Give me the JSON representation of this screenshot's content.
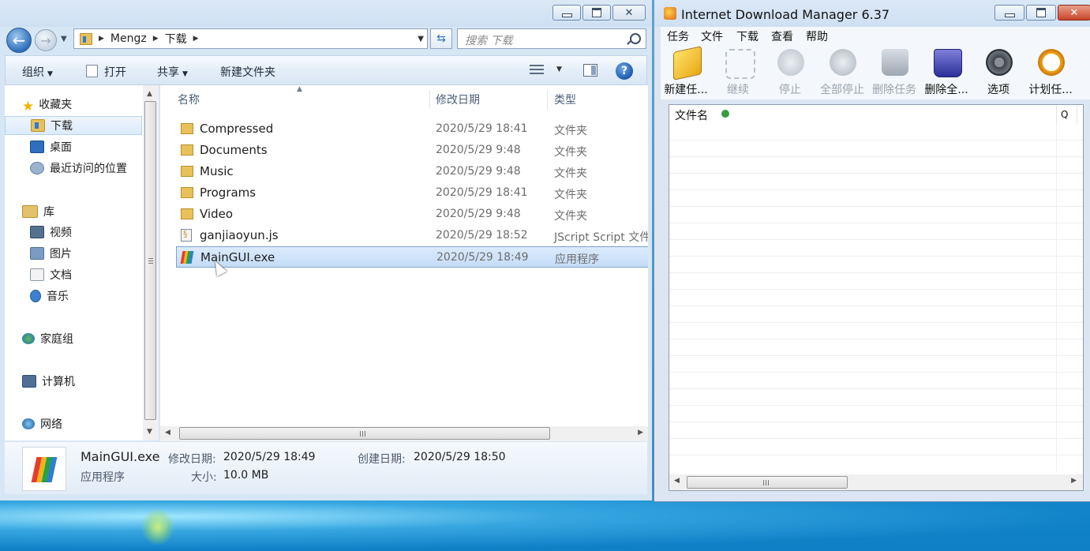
{
  "explorer": {
    "address": {
      "crumbs": [
        "Mengz",
        "下载"
      ]
    },
    "search": {
      "placeholder": "搜索 下载"
    },
    "toolbar": {
      "organize": "组织",
      "open": "打开",
      "share": "共享",
      "new_folder": "新建文件夹",
      "help": "?"
    },
    "nav": {
      "favorites": "收藏夹",
      "downloads": "下载",
      "desktop": "桌面",
      "recent": "最近访问的位置",
      "libraries": "库",
      "videos": "视频",
      "pictures": "图片",
      "documents": "文档",
      "music": "音乐",
      "homegroup": "家庭组",
      "computer": "计算机",
      "network": "网络"
    },
    "columns": {
      "name": "名称",
      "date": "修改日期",
      "type": "类型"
    },
    "files": [
      {
        "name": "Compressed",
        "date": "2020/5/29 18:41",
        "type": "文件夹",
        "icon": "folder-icon"
      },
      {
        "name": "Documents",
        "date": "2020/5/29 9:48",
        "type": "文件夹",
        "icon": "folder-icon"
      },
      {
        "name": "Music",
        "date": "2020/5/29 9:48",
        "type": "文件夹",
        "icon": "folder-icon"
      },
      {
        "name": "Programs",
        "date": "2020/5/29 18:41",
        "type": "文件夹",
        "icon": "folder-icon"
      },
      {
        "name": "Video",
        "date": "2020/5/29 9:48",
        "type": "文件夹",
        "icon": "folder-icon"
      },
      {
        "name": "ganjiaoyun.js",
        "date": "2020/5/29 18:52",
        "type": "JScript Script 文件",
        "icon": "script-file-icon"
      },
      {
        "name": "MainGUI.exe",
        "date": "2020/5/29 18:49",
        "type": "应用程序",
        "icon": "exe-file-icon",
        "selected": true
      }
    ],
    "details": {
      "name": "MainGUI.exe",
      "kind": "应用程序",
      "modified_label": "修改日期:",
      "modified": "2020/5/29 18:49",
      "created_label": "创建日期:",
      "created": "2020/5/29 18:50",
      "size_label": "大小:",
      "size": "10.0 MB"
    }
  },
  "idm": {
    "title": "Internet Download Manager 6.37",
    "menu": [
      "任务",
      "文件",
      "下载",
      "查看",
      "帮助"
    ],
    "toolbar": [
      {
        "label": "新建任...",
        "enabled": true,
        "icon": "new-task-icon"
      },
      {
        "label": "继续",
        "enabled": false,
        "icon": "resume-icon"
      },
      {
        "label": "停止",
        "enabled": false,
        "icon": "stop-icon"
      },
      {
        "label": "全部停止",
        "enabled": false,
        "icon": "stop-all-icon"
      },
      {
        "label": "删除任务",
        "enabled": false,
        "icon": "delete-task-icon"
      },
      {
        "label": "删除全...",
        "enabled": true,
        "icon": "delete-all-icon"
      },
      {
        "label": "选项",
        "enabled": true,
        "icon": "options-icon"
      },
      {
        "label": "计划任...",
        "enabled": true,
        "icon": "scheduler-icon"
      }
    ],
    "list": {
      "col_filename": "文件名",
      "col_q": "Q"
    }
  }
}
